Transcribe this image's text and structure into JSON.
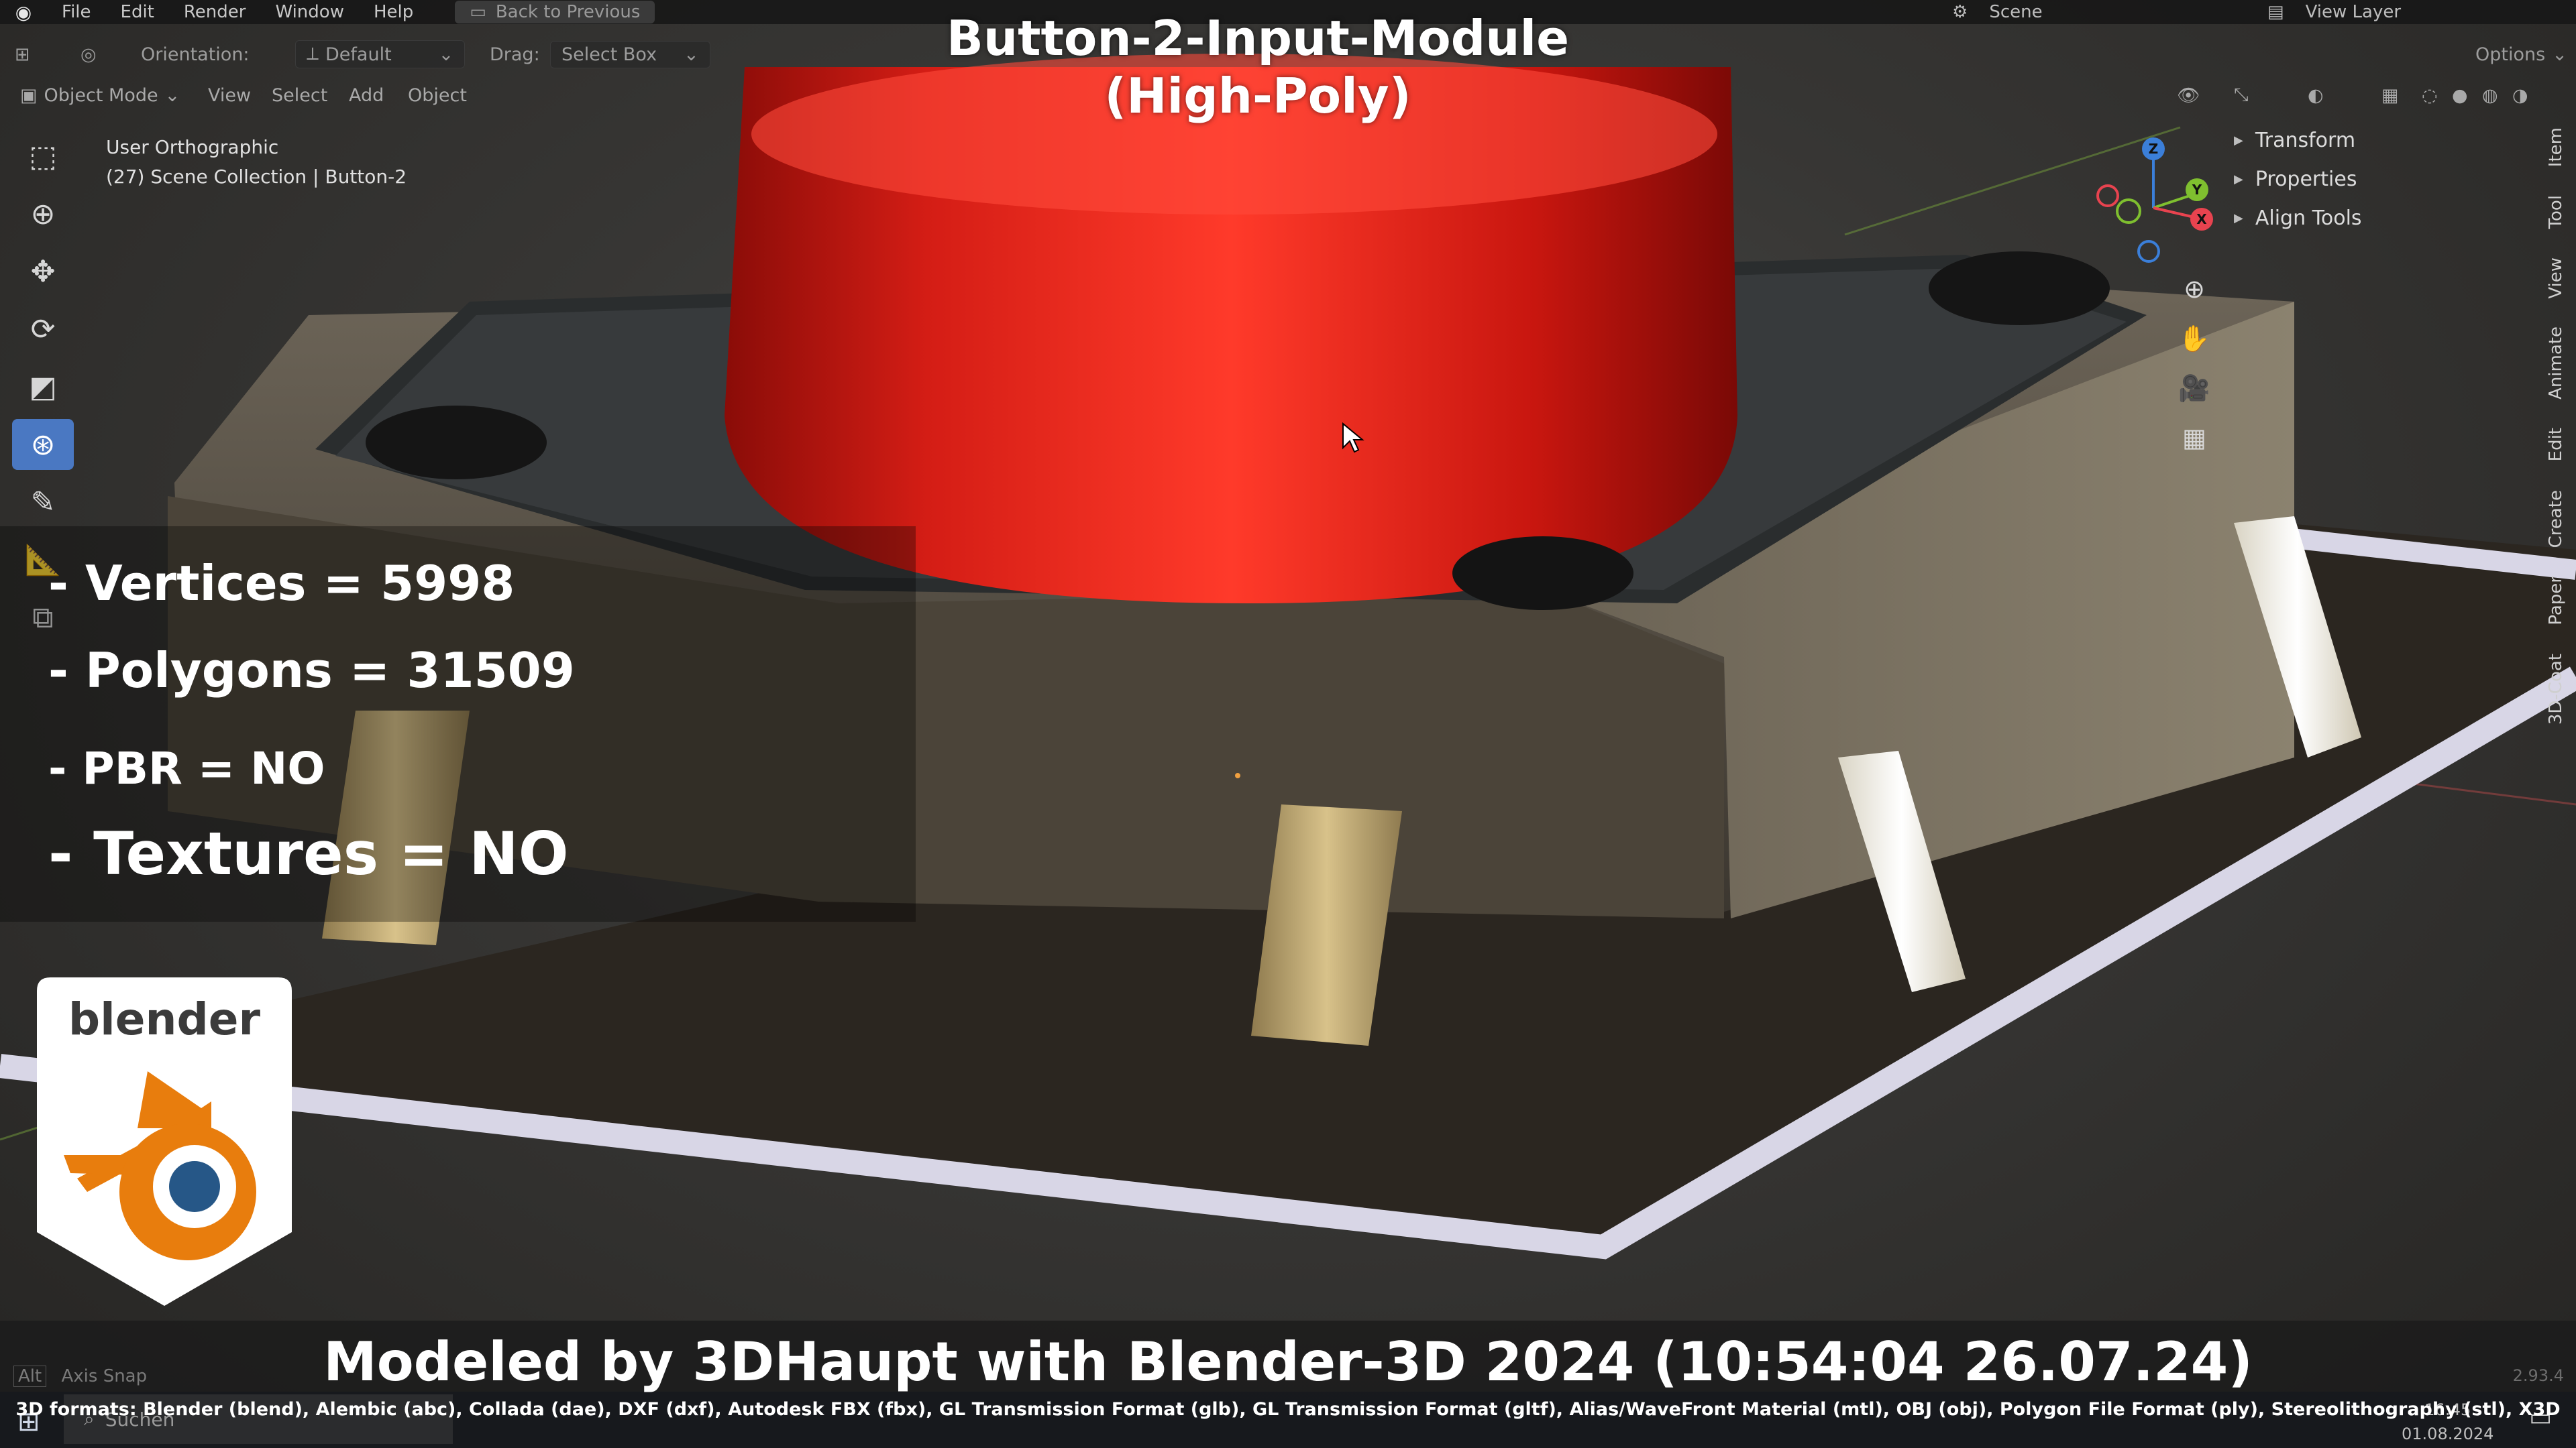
{
  "menu": {
    "items": [
      "File",
      "Edit",
      "Render",
      "Window",
      "Help"
    ],
    "back_label": "Back to Previous",
    "scene_label": "Scene",
    "view_layer_label": "View Layer"
  },
  "header": {
    "orientation_label": "Orientation:",
    "orientation_value": "Default",
    "drag_label": "Drag:",
    "drag_value": "Select Box",
    "options_label": "Options",
    "mode_value": "Object Mode",
    "view_label": "View",
    "select_label": "Select",
    "add_label": "Add",
    "object_label": "Object"
  },
  "viewport_info": {
    "view_name": "User Orthographic",
    "collection": "(27) Scene Collection | Button-2"
  },
  "npanel": {
    "sections": [
      "Transform",
      "Properties",
      "Align Tools"
    ],
    "tabs": [
      "Item",
      "Tool",
      "View",
      "Animate",
      "Edit",
      "Create",
      "Paper",
      "3D-Coat"
    ]
  },
  "gizmo": {
    "axis_x": "X",
    "axis_y": "Y",
    "axis_z": "Z",
    "color_x": "#e8434f",
    "color_y": "#7fbf2f",
    "color_z": "#3b7fd9"
  },
  "overlay": {
    "title_line1": "Button-2-Input-Module",
    "title_line2": "(High-Poly)",
    "vertices": "- Vertices = 5998",
    "polygons": "- Polygons = 31509",
    "pbr": "- PBR =  NO",
    "textures": "- Textures = NO",
    "logo_text": "blender",
    "modeled_by": "Modeled by 3DHaupt with Blender-3D 2024 (10:54:04  26.07.24)",
    "formats": "3D formats: Blender (blend), Alembic (abc), Collada (dae), DXF (dxf), Autodesk FBX (fbx), GL Transmission Format (glb), GL Transmission Format (gltf), Alias/WaveFront Material (mtl), OBJ (obj), Polygon File Format (ply), Stereolithography (stl), X3D"
  },
  "statusbar": {
    "alt_label": "Alt",
    "axis_snap": "Axis Snap",
    "version": "2.93.4"
  },
  "taskbar": {
    "search_placeholder": "Suchen",
    "time": "16:45",
    "date": "01.08.2024"
  },
  "colors": {
    "accent_blue": "#4a78c2",
    "button_red": "#e0271f",
    "blender_orange": "#e87d0d",
    "blender_blue": "#265787"
  }
}
